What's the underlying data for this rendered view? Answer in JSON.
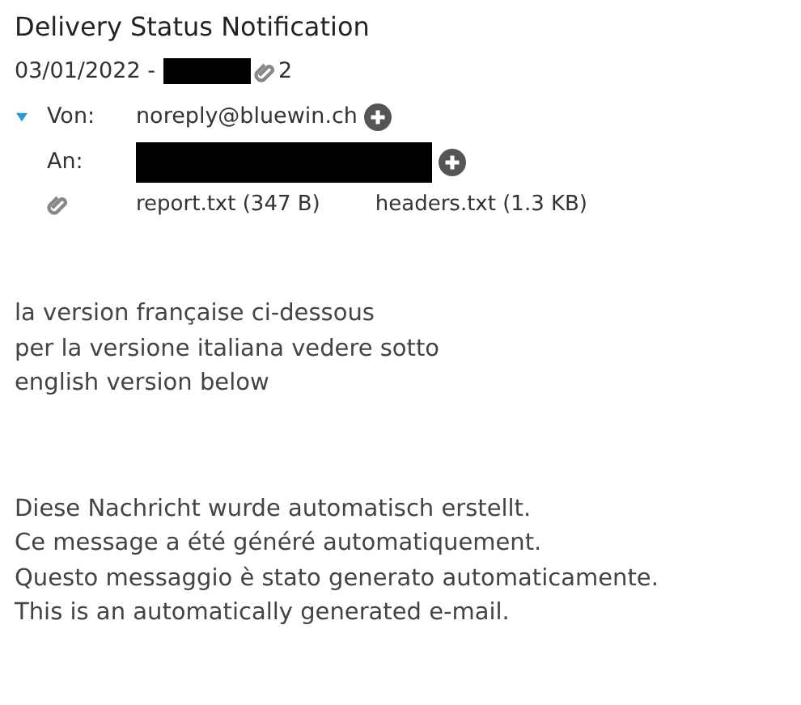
{
  "subject": "Delivery Status Notification",
  "meta": {
    "date": "03/01/2022 -",
    "sender_redacted": true,
    "attachment_count": "2"
  },
  "headers": {
    "expanded": true,
    "from": {
      "label": "Von:",
      "value": "noreply@bluewin.ch"
    },
    "to": {
      "label": "An:",
      "redacted": true
    },
    "attachments": [
      {
        "name": "report.txt (347 B)"
      },
      {
        "name": "headers.txt (1.3 KB)"
      }
    ]
  },
  "body": [
    [
      "la version française ci-dessous",
      "per la versione italiana vedere sotto",
      "english version below"
    ],
    [
      "Diese Nachricht wurde automatisch erstellt.",
      "Ce message a été généré automatiquement.",
      "Questo messaggio è stato generato automaticamente.",
      "This is an automatically generated e-mail."
    ]
  ]
}
